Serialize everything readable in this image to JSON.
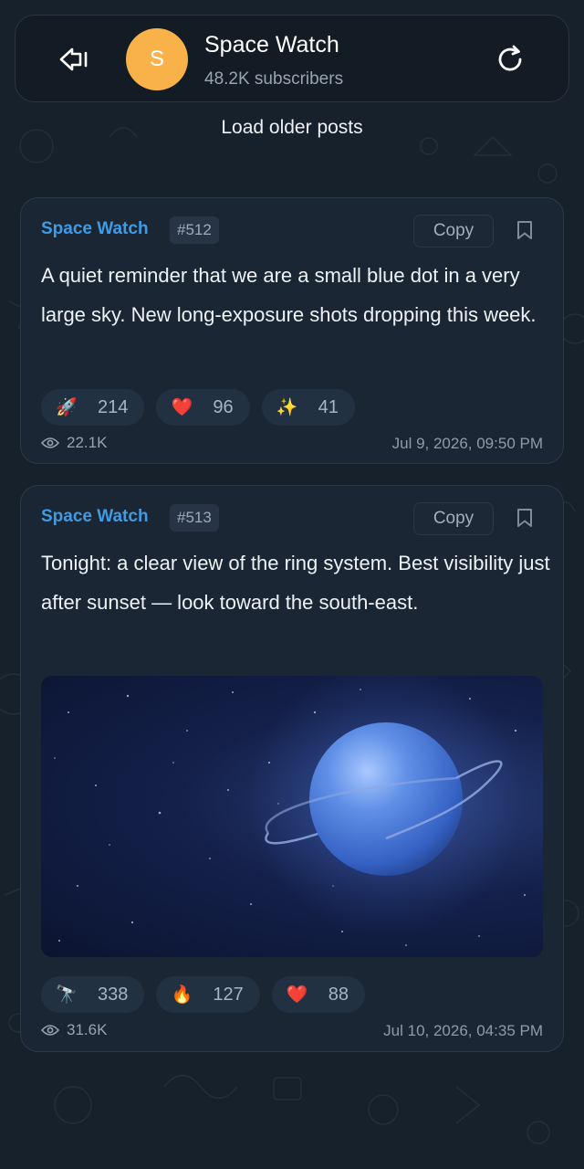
{
  "channel": {
    "name": "Space Watch",
    "subscribers": "48.2K subscribers",
    "avatar_letter": "S",
    "avatar_color": "#f9b24a"
  },
  "load_older": "Load older posts",
  "posts": [
    {
      "author": "Space Watch",
      "id": "#512",
      "copy_label": "Copy",
      "text": "A quiet reminder that we are a small blue dot in a very large sky. New long-exposure shots dropping this week.",
      "reactions": [
        {
          "emoji": "🚀",
          "count": "214"
        },
        {
          "emoji": "❤️",
          "count": "96"
        },
        {
          "emoji": "✨",
          "count": "41"
        }
      ],
      "views": "22.1K",
      "timestamp": "Jul 9, 2026, 09:50 PM"
    },
    {
      "author": "Space Watch",
      "id": "#513",
      "copy_label": "Copy",
      "text": "Tonight: a clear view of the ring system. Best visibility just after sunset — look toward the south-east.",
      "image": "planet-with-ring-photo",
      "reactions": [
        {
          "emoji": "🔭",
          "count": "338"
        },
        {
          "emoji": "🔥",
          "count": "127"
        },
        {
          "emoji": "❤️",
          "count": "88"
        }
      ],
      "views": "31.6K",
      "timestamp": "Jul 10, 2026, 04:35 PM"
    }
  ],
  "colors": {
    "background": "#17212b",
    "accent": "#3f9be6",
    "card": "#1a2633"
  }
}
